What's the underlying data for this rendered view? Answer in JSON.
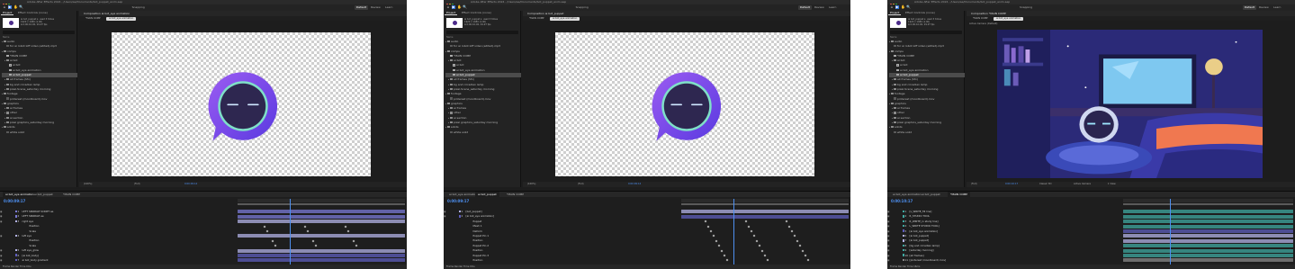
{
  "app": {
    "title": "Adobe After Effects 2024 - /Users/ae/Documents/bot_puppet_anim.aep",
    "window_dots": [
      "#ff5f57",
      "#febc2e",
      "#28c840"
    ],
    "tools": [
      "⌂",
      "▶",
      "✋",
      "🔍"
    ],
    "snapping_label": "Snapping",
    "workspaces": [
      "Default",
      "Review",
      "Learn"
    ]
  },
  "project": {
    "tab_project": "Project",
    "tab_effects": "Effect Controls (none)",
    "col_name": "Name",
    "thumb_info": "ai bot_puppet ▾, used 3 times\n1920 x 1080 (1.00)\nΔ 0;00;10;00, 29.97 fps"
  },
  "screens": [
    {
      "comp_tab": "Composition ai bot_eye animation",
      "crumbs": [
        "*MAIN COMP",
        "ai bot_eye animation"
      ],
      "status": [
        "(100%)",
        "(Full)",
        "0:00:09:14"
      ],
      "tree": [
        {
          "t": "audio",
          "k": "folder",
          "i": 0
        },
        {
          "t": "for ai robot loff video (edited).mp3",
          "k": "file",
          "i": 1
        },
        {
          "t": "comps",
          "k": "folder",
          "i": 0
        },
        {
          "t": "*MAIN COMP",
          "k": "comp",
          "i": 1
        },
        {
          "t": "ai bot",
          "k": "folder",
          "i": 1
        },
        {
          "t": "ai bot",
          "k": "comp",
          "i": 2
        },
        {
          "t": "ai bot_eye animation",
          "k": "comp",
          "i": 2
        },
        {
          "t": "ai bot_puppet",
          "k": "comp",
          "i": 2,
          "sel": true
        },
        {
          "t": "all frames (Sfx)",
          "k": "folder",
          "i": 1
        },
        {
          "t": "bg and circadian lamp",
          "k": "folder",
          "i": 1
        },
        {
          "t": "pixel-Scene_saturday morning",
          "k": "folder",
          "i": 1
        },
        {
          "t": "footage",
          "k": "folder",
          "i": 0
        },
        {
          "t": "pinterest (moodboard).mov",
          "k": "file",
          "i": 1
        },
        {
          "t": "graphics",
          "k": "folder",
          "i": 0
        },
        {
          "t": "ai frames",
          "k": "folder",
          "i": 1
        },
        {
          "t": "other",
          "k": "folder",
          "i": 1
        },
        {
          "t": "ai section",
          "k": "folder",
          "i": 1
        },
        {
          "t": "pixel graphics_saturday morning",
          "k": "folder",
          "i": 1
        },
        {
          "t": "solids",
          "k": "folder",
          "i": 0
        },
        {
          "t": "white solid",
          "k": "file",
          "i": 1
        }
      ],
      "tl_tabs": [
        "ai bot_eye animation",
        "ai bot_puppet",
        "*MAIN COMP"
      ],
      "timecode": "0:00:09:17",
      "layers": [
        {
          "n": "1",
          "name": "LEFT SPARKLE SCRIPT ae",
          "c": "#7a7ad6"
        },
        {
          "n": "2",
          "name": "LEFT SPARKLE ae",
          "c": "#7a7ad6"
        },
        {
          "n": "3",
          "name": "right eye",
          "c": "#b2b2e6"
        },
        {
          "n": "",
          "name": "Position",
          "c": ""
        },
        {
          "n": "",
          "name": "Scale",
          "c": ""
        },
        {
          "n": "4",
          "name": "left eye",
          "c": "#b2b2e6"
        },
        {
          "n": "",
          "name": "Position",
          "c": ""
        },
        {
          "n": "",
          "name": "Scale",
          "c": ""
        },
        {
          "n": "5",
          "name": "left eye_glow",
          "c": "#b2b2e6"
        },
        {
          "n": "6",
          "name": "[ai bot_body]",
          "c": "#5d5dbb"
        },
        {
          "n": "7",
          "name": "ai bot_body gradient",
          "c": "#5d5dbb"
        }
      ],
      "footer": "Frame Render Time  0ms"
    },
    {
      "comp_tab": "Composition ai bot_puppet",
      "crumbs": [
        "*MAIN COMP",
        "ai bot_eye animation"
      ],
      "status": [
        "(100%)",
        "(Full)",
        "0:00:09:14"
      ],
      "tree": [
        {
          "t": "audio",
          "k": "folder",
          "i": 0
        },
        {
          "t": "for ai robot loff video (edited).mp3",
          "k": "file",
          "i": 1
        },
        {
          "t": "comps",
          "k": "folder",
          "i": 0
        },
        {
          "t": "*MAIN COMP",
          "k": "comp",
          "i": 1
        },
        {
          "t": "ai bot",
          "k": "folder",
          "i": 1
        },
        {
          "t": "ai bot",
          "k": "comp",
          "i": 2
        },
        {
          "t": "ai bot_eye animation",
          "k": "comp",
          "i": 2
        },
        {
          "t": "ai bot_puppet",
          "k": "comp",
          "i": 2,
          "sel": true
        },
        {
          "t": "all frames (Sfx)",
          "k": "folder",
          "i": 1
        },
        {
          "t": "bg and circadian lamp",
          "k": "folder",
          "i": 1
        },
        {
          "t": "pixel-Scene_saturday morning",
          "k": "folder",
          "i": 1
        },
        {
          "t": "footage",
          "k": "folder",
          "i": 0
        },
        {
          "t": "pinterest (moodboard).mov",
          "k": "file",
          "i": 1
        },
        {
          "t": "graphics",
          "k": "folder",
          "i": 0
        },
        {
          "t": "ai frames",
          "k": "folder",
          "i": 1
        },
        {
          "t": "other",
          "k": "folder",
          "i": 1
        },
        {
          "t": "ai section",
          "k": "folder",
          "i": 1
        },
        {
          "t": "pixel graphics_saturday morning",
          "k": "folder",
          "i": 1
        },
        {
          "t": "solids",
          "k": "folder",
          "i": 0
        },
        {
          "t": "white solid",
          "k": "file",
          "i": 1
        }
      ],
      "tl_tabs": [
        "ai bot_eye animation",
        "ai bot_puppet",
        "*MAIN COMP"
      ],
      "timecode": "0:00:09:17",
      "layers": [
        {
          "n": "1",
          "name": "[bot_puppet]",
          "c": "#b2b2e6"
        },
        {
          "n": "2",
          "name": "[ai bot_eye animation]",
          "c": "#5d5dbb"
        },
        {
          "n": "",
          "name": "Puppet",
          "c": ""
        },
        {
          "n": "",
          "name": "Mesh 1",
          "c": ""
        },
        {
          "n": "",
          "name": "Deform",
          "c": ""
        },
        {
          "n": "",
          "name": "Puppet Pin 1",
          "c": ""
        },
        {
          "n": "",
          "name": "Position",
          "c": ""
        },
        {
          "n": "",
          "name": "Puppet Pin 2",
          "c": ""
        },
        {
          "n": "",
          "name": "Position",
          "c": ""
        },
        {
          "n": "",
          "name": "Puppet Pin 3",
          "c": ""
        },
        {
          "n": "",
          "name": "Position",
          "c": ""
        }
      ],
      "footer": "Frame Render Time  0ms"
    },
    {
      "comp_tab": "Composition *MAIN COMP",
      "crumbs": [
        "*MAIN COMP",
        "ai bot_eye animation"
      ],
      "status": [
        "(Full)",
        "0:00:10:17",
        "Classic 3D",
        "Active Camera",
        "1 View"
      ],
      "active_camera": "Active Camera (Default)",
      "tree": [
        {
          "t": "audio",
          "k": "folder",
          "i": 0
        },
        {
          "t": "for ai robot loff video (edited).mp3",
          "k": "file",
          "i": 1
        },
        {
          "t": "comps",
          "k": "folder",
          "i": 0
        },
        {
          "t": "*MAIN COMP",
          "k": "comp",
          "i": 1
        },
        {
          "t": "ai bot",
          "k": "folder",
          "i": 1
        },
        {
          "t": "ai bot",
          "k": "comp",
          "i": 2
        },
        {
          "t": "ai bot_eye animation",
          "k": "comp",
          "i": 2
        },
        {
          "t": "ai bot_puppet",
          "k": "comp",
          "i": 2,
          "sel": true
        },
        {
          "t": "all frames (Sfx)",
          "k": "folder",
          "i": 1
        },
        {
          "t": "bg and circadian lamp",
          "k": "folder",
          "i": 1
        },
        {
          "t": "pixel-Scene_saturday morning",
          "k": "folder",
          "i": 1
        },
        {
          "t": "footage",
          "k": "folder",
          "i": 0
        },
        {
          "t": "pinterest (moodboard).mov",
          "k": "file",
          "i": 1
        },
        {
          "t": "graphics",
          "k": "folder",
          "i": 0
        },
        {
          "t": "ai frames",
          "k": "folder",
          "i": 1
        },
        {
          "t": "other",
          "k": "folder",
          "i": 1
        },
        {
          "t": "ai section",
          "k": "folder",
          "i": 1
        },
        {
          "t": "pixel graphics_saturday morning",
          "k": "folder",
          "i": 1
        },
        {
          "t": "solids",
          "k": "folder",
          "i": 0
        },
        {
          "t": "white solid",
          "k": "file",
          "i": 1
        }
      ],
      "tl_tabs": [
        "ai bot_eye animation",
        "ai bot_puppet",
        "*MAIN COMP"
      ],
      "timecode": "0:00:10:17",
      "layers": [
        {
          "n": "1",
          "name": "[L_WRITE_fill line]",
          "c": "#3fa8a0"
        },
        {
          "n": "2",
          "name": "R_STUDIO TOOL",
          "c": "#3fa8a0"
        },
        {
          "n": "3",
          "name": "R_WRITE_in study line]",
          "c": "#3fa8a0"
        },
        {
          "n": "4",
          "name": "L_WRITE STUDIO TOOL]",
          "c": "#3fa8a0"
        },
        {
          "n": "5",
          "name": "[ai bot_eye animation]",
          "c": "#5d5dbb"
        },
        {
          "n": "6",
          "name": "[ai bot_puppet]",
          "c": "#b2b2e6"
        },
        {
          "n": "7",
          "name": "[ai bot_puppet]",
          "c": "#b2b2e6"
        },
        {
          "n": "8",
          "name": "[bg and circadian lamp]",
          "c": "#3fa8a0"
        },
        {
          "n": "9",
          "name": "[saturday morning]",
          "c": "#3fa8a0"
        },
        {
          "n": "10",
          "name": "[all frames]",
          "c": "#3fa8a0"
        },
        {
          "n": "11",
          "name": "[pinterest (moodboard).mov]",
          "c": "#888888"
        }
      ],
      "footer": "Frame Render Time  16ms"
    }
  ],
  "colors": {
    "accent_blue": "#2d6fd6",
    "timecode_blue": "#4d8ff0",
    "bot_purple": "#7b3fe4",
    "bot_ring": "#7fe0c8"
  }
}
